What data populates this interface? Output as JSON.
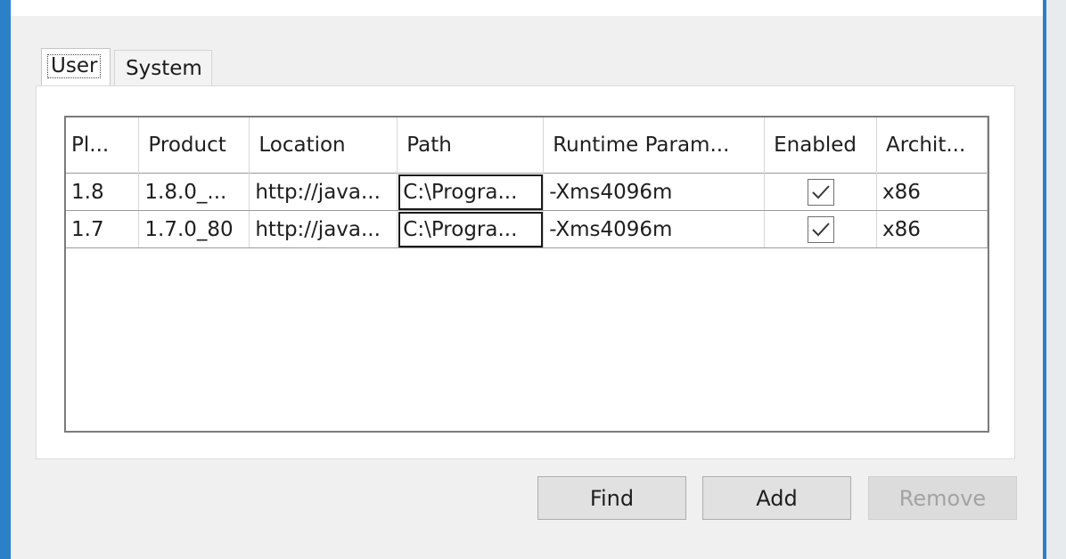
{
  "tabs": [
    {
      "label": "User",
      "selected": true
    },
    {
      "label": "System",
      "selected": false
    }
  ],
  "table": {
    "columns": [
      "Pl...",
      "Product",
      "Location",
      "Path",
      "Runtime Param...",
      "Enabled",
      "Archit..."
    ],
    "rows": [
      {
        "platform": "1.8",
        "product": "1.8.0_...",
        "location": "http://java...",
        "path": "C:\\Progra...",
        "runtime_params": "-Xms4096m",
        "enabled": true,
        "architecture": "x86"
      },
      {
        "platform": "1.7",
        "product": "1.7.0_80",
        "location": "http://java...",
        "path": "C:\\Progra...",
        "runtime_params": "-Xms4096m",
        "enabled": true,
        "architecture": "x86"
      }
    ]
  },
  "buttons": {
    "find": "Find",
    "add": "Add",
    "remove": "Remove"
  },
  "colors": {
    "window_frame": "#2c80c8",
    "disabled_text": "#a3a3a3"
  }
}
